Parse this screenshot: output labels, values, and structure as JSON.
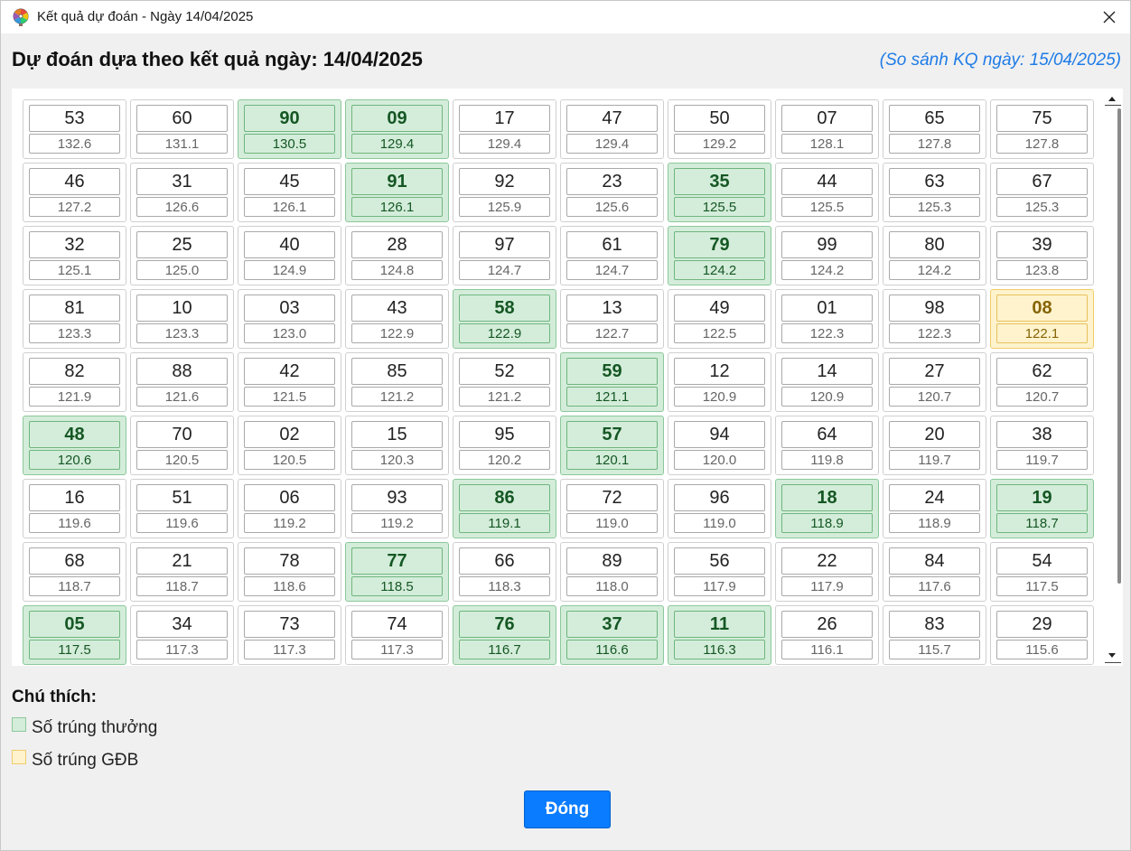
{
  "window": {
    "title": "Kết quả dự đoán - Ngày 14/04/2025",
    "icon": "wheel-icon"
  },
  "header": {
    "heading": "Dự đoán dựa theo kết quả ngày: 14/04/2025",
    "compare": "(So sánh KQ ngày: 15/04/2025)"
  },
  "colors": {
    "win_bg": "#d4edda",
    "jackpot_bg": "#fff3cd",
    "primary": "#0a7cff",
    "link": "#1e7be6"
  },
  "grid": {
    "cells": [
      {
        "num": "53",
        "score": "132.6",
        "status": ""
      },
      {
        "num": "60",
        "score": "131.1",
        "status": ""
      },
      {
        "num": "90",
        "score": "130.5",
        "status": "win"
      },
      {
        "num": "09",
        "score": "129.4",
        "status": "win"
      },
      {
        "num": "17",
        "score": "129.4",
        "status": ""
      },
      {
        "num": "47",
        "score": "129.4",
        "status": ""
      },
      {
        "num": "50",
        "score": "129.2",
        "status": ""
      },
      {
        "num": "07",
        "score": "128.1",
        "status": ""
      },
      {
        "num": "65",
        "score": "127.8",
        "status": ""
      },
      {
        "num": "75",
        "score": "127.8",
        "status": ""
      },
      {
        "num": "46",
        "score": "127.2",
        "status": ""
      },
      {
        "num": "31",
        "score": "126.6",
        "status": ""
      },
      {
        "num": "45",
        "score": "126.1",
        "status": ""
      },
      {
        "num": "91",
        "score": "126.1",
        "status": "win"
      },
      {
        "num": "92",
        "score": "125.9",
        "status": ""
      },
      {
        "num": "23",
        "score": "125.6",
        "status": ""
      },
      {
        "num": "35",
        "score": "125.5",
        "status": "win"
      },
      {
        "num": "44",
        "score": "125.5",
        "status": ""
      },
      {
        "num": "63",
        "score": "125.3",
        "status": ""
      },
      {
        "num": "67",
        "score": "125.3",
        "status": ""
      },
      {
        "num": "32",
        "score": "125.1",
        "status": ""
      },
      {
        "num": "25",
        "score": "125.0",
        "status": ""
      },
      {
        "num": "40",
        "score": "124.9",
        "status": ""
      },
      {
        "num": "28",
        "score": "124.8",
        "status": ""
      },
      {
        "num": "97",
        "score": "124.7",
        "status": ""
      },
      {
        "num": "61",
        "score": "124.7",
        "status": ""
      },
      {
        "num": "79",
        "score": "124.2",
        "status": "win"
      },
      {
        "num": "99",
        "score": "124.2",
        "status": ""
      },
      {
        "num": "80",
        "score": "124.2",
        "status": ""
      },
      {
        "num": "39",
        "score": "123.8",
        "status": ""
      },
      {
        "num": "81",
        "score": "123.3",
        "status": ""
      },
      {
        "num": "10",
        "score": "123.3",
        "status": ""
      },
      {
        "num": "03",
        "score": "123.0",
        "status": ""
      },
      {
        "num": "43",
        "score": "122.9",
        "status": ""
      },
      {
        "num": "58",
        "score": "122.9",
        "status": "win"
      },
      {
        "num": "13",
        "score": "122.7",
        "status": ""
      },
      {
        "num": "49",
        "score": "122.5",
        "status": ""
      },
      {
        "num": "01",
        "score": "122.3",
        "status": ""
      },
      {
        "num": "98",
        "score": "122.3",
        "status": ""
      },
      {
        "num": "08",
        "score": "122.1",
        "status": "jackpot"
      },
      {
        "num": "82",
        "score": "121.9",
        "status": ""
      },
      {
        "num": "88",
        "score": "121.6",
        "status": ""
      },
      {
        "num": "42",
        "score": "121.5",
        "status": ""
      },
      {
        "num": "85",
        "score": "121.2",
        "status": ""
      },
      {
        "num": "52",
        "score": "121.2",
        "status": ""
      },
      {
        "num": "59",
        "score": "121.1",
        "status": "win"
      },
      {
        "num": "12",
        "score": "120.9",
        "status": ""
      },
      {
        "num": "14",
        "score": "120.9",
        "status": ""
      },
      {
        "num": "27",
        "score": "120.7",
        "status": ""
      },
      {
        "num": "62",
        "score": "120.7",
        "status": ""
      },
      {
        "num": "48",
        "score": "120.6",
        "status": "win"
      },
      {
        "num": "70",
        "score": "120.5",
        "status": ""
      },
      {
        "num": "02",
        "score": "120.5",
        "status": ""
      },
      {
        "num": "15",
        "score": "120.3",
        "status": ""
      },
      {
        "num": "95",
        "score": "120.2",
        "status": ""
      },
      {
        "num": "57",
        "score": "120.1",
        "status": "win"
      },
      {
        "num": "94",
        "score": "120.0",
        "status": ""
      },
      {
        "num": "64",
        "score": "119.8",
        "status": ""
      },
      {
        "num": "20",
        "score": "119.7",
        "status": ""
      },
      {
        "num": "38",
        "score": "119.7",
        "status": ""
      },
      {
        "num": "16",
        "score": "119.6",
        "status": ""
      },
      {
        "num": "51",
        "score": "119.6",
        "status": ""
      },
      {
        "num": "06",
        "score": "119.2",
        "status": ""
      },
      {
        "num": "93",
        "score": "119.2",
        "status": ""
      },
      {
        "num": "86",
        "score": "119.1",
        "status": "win"
      },
      {
        "num": "72",
        "score": "119.0",
        "status": ""
      },
      {
        "num": "96",
        "score": "119.0",
        "status": ""
      },
      {
        "num": "18",
        "score": "118.9",
        "status": "win"
      },
      {
        "num": "24",
        "score": "118.9",
        "status": ""
      },
      {
        "num": "19",
        "score": "118.7",
        "status": "win"
      },
      {
        "num": "68",
        "score": "118.7",
        "status": ""
      },
      {
        "num": "21",
        "score": "118.7",
        "status": ""
      },
      {
        "num": "78",
        "score": "118.6",
        "status": ""
      },
      {
        "num": "77",
        "score": "118.5",
        "status": "win"
      },
      {
        "num": "66",
        "score": "118.3",
        "status": ""
      },
      {
        "num": "89",
        "score": "118.0",
        "status": ""
      },
      {
        "num": "56",
        "score": "117.9",
        "status": ""
      },
      {
        "num": "22",
        "score": "117.9",
        "status": ""
      },
      {
        "num": "84",
        "score": "117.6",
        "status": ""
      },
      {
        "num": "54",
        "score": "117.5",
        "status": ""
      },
      {
        "num": "05",
        "score": "117.5",
        "status": "win"
      },
      {
        "num": "34",
        "score": "117.3",
        "status": ""
      },
      {
        "num": "73",
        "score": "117.3",
        "status": ""
      },
      {
        "num": "74",
        "score": "117.3",
        "status": ""
      },
      {
        "num": "76",
        "score": "116.7",
        "status": "win"
      },
      {
        "num": "37",
        "score": "116.6",
        "status": "win"
      },
      {
        "num": "11",
        "score": "116.3",
        "status": "win"
      },
      {
        "num": "26",
        "score": "116.1",
        "status": ""
      },
      {
        "num": "83",
        "score": "115.7",
        "status": ""
      },
      {
        "num": "29",
        "score": "115.6",
        "status": ""
      }
    ]
  },
  "legend": {
    "title": "Chú thích:",
    "win_label": "Số trúng thưởng",
    "jackpot_label": "Số trúng GĐB"
  },
  "footer": {
    "close_label": "Đóng"
  }
}
